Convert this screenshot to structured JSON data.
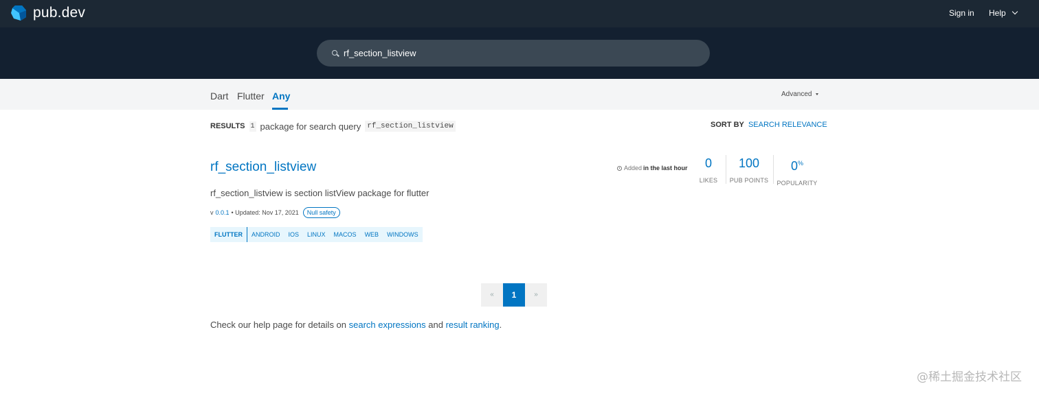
{
  "topnav": {
    "logo_text": "pub.dev",
    "signin_label": "Sign in",
    "help_label": "Help"
  },
  "search": {
    "value": "rf_section_listview"
  },
  "tabs": [
    {
      "label": "Dart",
      "active": false
    },
    {
      "label": "Flutter",
      "active": false
    },
    {
      "label": "Any",
      "active": true
    }
  ],
  "advanced_label": "Advanced",
  "results": {
    "label": "RESULTS",
    "count": "1",
    "text": "package for search query",
    "query": "rf_section_listview"
  },
  "sort": {
    "label": "SORT BY",
    "value": "SEARCH RELEVANCE"
  },
  "package": {
    "name": "rf_section_listview",
    "description": "rf_section_listview is section listView package for flutter",
    "version_prefix": "v",
    "version": "0.0.1",
    "updated": "• Updated: Nov 17, 2021",
    "badge": "Null safety",
    "sdk_tag": "FLUTTER",
    "platform_tags": [
      "ANDROID",
      "IOS",
      "LINUX",
      "MACOS",
      "WEB",
      "WINDOWS"
    ],
    "added_prefix": "Added",
    "added_when": "in the last hour",
    "stats": {
      "likes_value": "0",
      "likes_label": "LIKES",
      "points_value": "100",
      "points_label": "PUB POINTS",
      "popularity_value": "0",
      "popularity_unit": "%",
      "popularity_label": "POPULARITY"
    }
  },
  "pagination": {
    "prev": "«",
    "current": "1",
    "next": "»"
  },
  "help_line": {
    "prefix": "Check our help page for details on",
    "link1": "search expressions",
    "middle": "and",
    "link2": "result ranking",
    "suffix": "."
  },
  "watermark": "@稀土掘金技术社区",
  "colors": {
    "accent": "#0175c2",
    "topnav_bg": "#1c2834",
    "banner_bg": "#132030"
  }
}
